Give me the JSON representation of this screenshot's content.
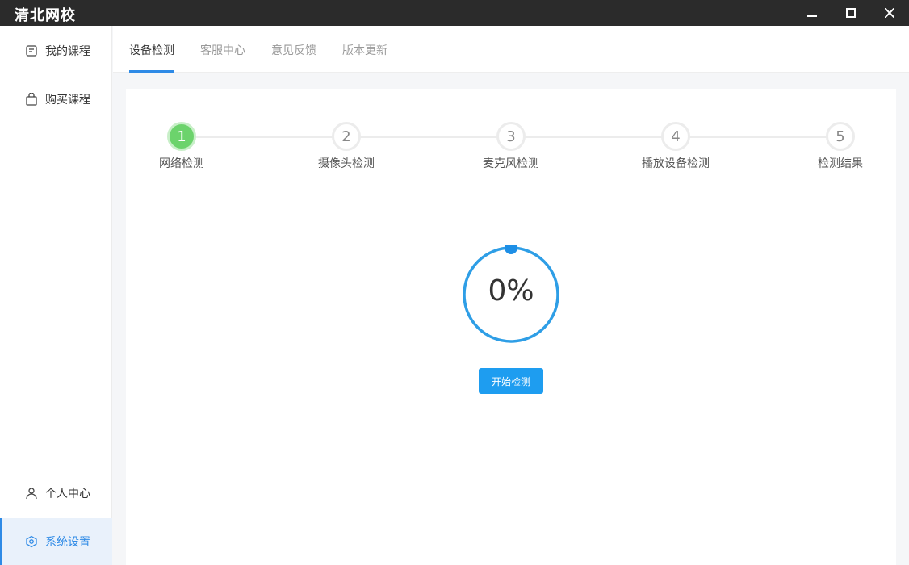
{
  "app": {
    "title": "清北网校"
  },
  "window_controls": {
    "minimize_icon": "minimize-icon",
    "maximize_icon": "maximize-icon",
    "close_icon": "close-icon"
  },
  "sidebar": {
    "items": [
      {
        "label": "我的课程",
        "icon": "course-icon"
      },
      {
        "label": "购买课程",
        "icon": "shopping-bag-icon"
      },
      {
        "label": "个人中心",
        "icon": "user-icon"
      },
      {
        "label": "系统设置",
        "icon": "settings-icon",
        "active": true
      }
    ]
  },
  "tabs": [
    {
      "label": "设备检测",
      "active": true
    },
    {
      "label": "客服中心"
    },
    {
      "label": "意见反馈"
    },
    {
      "label": "版本更新"
    }
  ],
  "steps": [
    {
      "num": "1",
      "label": "网络检测",
      "done": true
    },
    {
      "num": "2",
      "label": "摄像头检测"
    },
    {
      "num": "3",
      "label": "麦克风检测"
    },
    {
      "num": "4",
      "label": "播放设备检测"
    },
    {
      "num": "5",
      "label": "检测结果"
    }
  ],
  "progress": {
    "text": "0%",
    "value": 0
  },
  "start_button": {
    "label": "开始检测"
  },
  "colors": {
    "accent": "#2e8ae6",
    "button": "#1e9df0",
    "done_step": "#6cd36c",
    "titlebar": "#2b2b2b"
  }
}
